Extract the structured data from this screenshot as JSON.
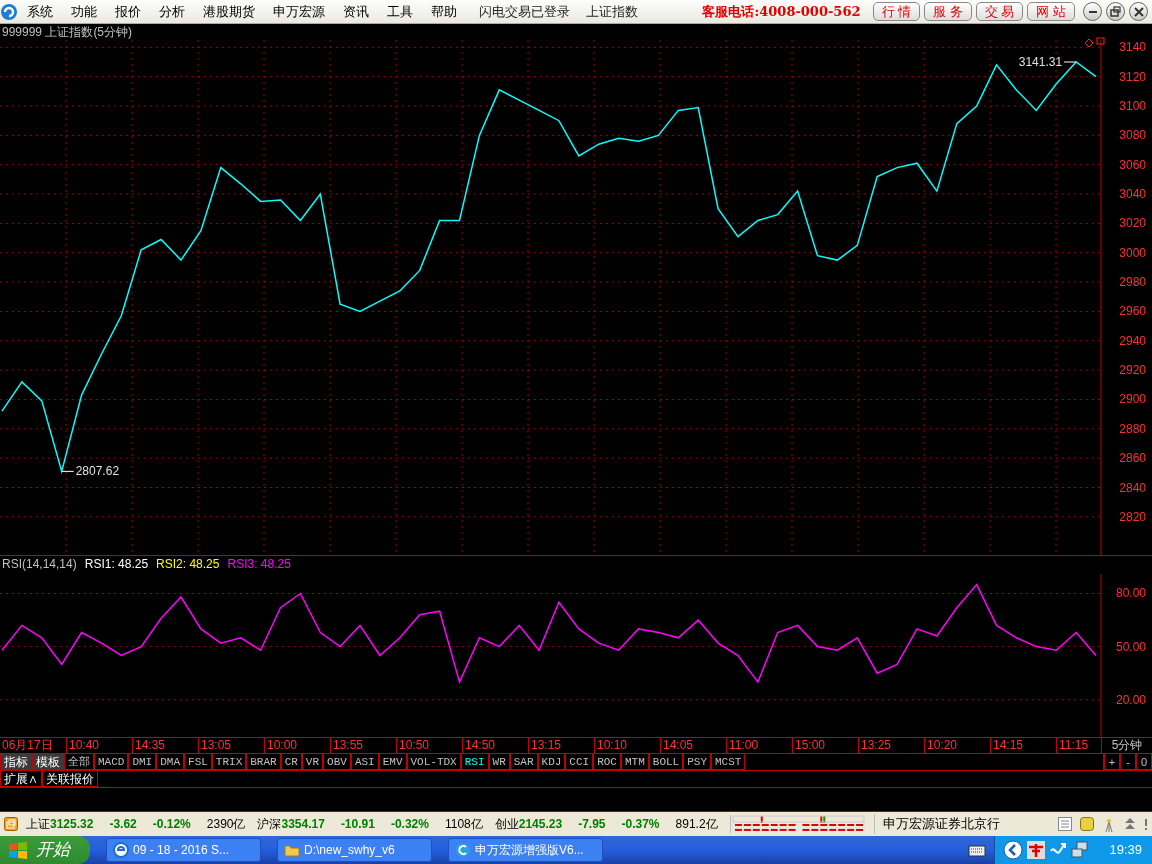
{
  "menu": {
    "items": [
      "系统",
      "功能",
      "报价",
      "分析",
      "港股期货",
      "申万宏源",
      "资讯",
      "工具",
      "帮助"
    ],
    "status_texts": [
      "闪电交易已登录",
      "上证指数"
    ],
    "hotline": "客服电话:4008-000-562",
    "buttons": [
      "行 情",
      "服 务",
      "交 易",
      "网 站"
    ]
  },
  "price_chart": {
    "chart_data": {
      "type": "line",
      "title": "999999 上证指数(5分钟)",
      "ylim": [
        2794,
        3145
      ],
      "grid": true,
      "yticks": [
        2820,
        2840,
        2860,
        2880,
        2900,
        2920,
        2940,
        2960,
        2980,
        3000,
        3020,
        3040,
        3060,
        3080,
        3100,
        3120,
        3140
      ],
      "series": [
        {
          "color": "#00ffff",
          "values": [
            2892,
            2912,
            2899,
            2851,
            2903,
            2931,
            2957,
            3002,
            3009,
            2995,
            3015,
            3058,
            3047,
            3035,
            3036,
            3022,
            3040,
            2965,
            2960,
            2967,
            2974,
            2988,
            3022,
            3022,
            3080,
            3111,
            3104,
            3097,
            3090,
            3066,
            3074,
            3078,
            3076,
            3080,
            3097,
            3099,
            3030,
            3011,
            3022,
            3026,
            3042,
            2998,
            2995,
            3005,
            3052,
            3058,
            3061,
            3042,
            3088,
            3100,
            3128,
            3111,
            3097,
            3115,
            3130,
            3120
          ]
        }
      ],
      "annotations": [
        "3141.31",
        "2807.62"
      ]
    }
  },
  "rsi_chart": {
    "legend": [
      {
        "text": "RSI(14,14,14)",
        "color": "#c0c0c0"
      },
      {
        "text": "RSI1: 48.25",
        "color": "#ffffff"
      },
      {
        "text": "RSI2: 48.25",
        "color": "#ffff00"
      },
      {
        "text": "RSI3: 48.25",
        "color": "#ff00ff"
      }
    ],
    "chart_data": {
      "type": "line",
      "ylim": [
        -1,
        91
      ],
      "grid": true,
      "yticks": [
        {
          "value": 20,
          "label": "20.00"
        },
        {
          "value": 50,
          "label": "50.00"
        },
        {
          "value": 80,
          "label": "80.00"
        }
      ],
      "series": [
        {
          "color": "#ff00ff",
          "values": [
            48,
            62,
            55,
            40,
            58,
            52,
            45,
            50,
            66,
            78,
            60,
            52,
            55,
            48,
            72,
            80,
            58,
            50,
            62,
            45,
            55,
            68,
            70,
            30,
            55,
            50,
            62,
            48,
            75,
            60,
            52,
            48,
            60,
            58,
            55,
            65,
            52,
            45,
            30,
            58,
            62,
            50,
            48,
            55,
            35,
            40,
            60,
            56,
            72,
            85,
            62,
            55,
            50,
            48,
            58,
            45
          ]
        }
      ]
    }
  },
  "time_axis": {
    "labels": [
      "06月17日",
      "10:40",
      "14:35",
      "13:05",
      "10:00",
      "13:55",
      "10:50",
      "14:50",
      "13:15",
      "10:10",
      "14:05",
      "11:00",
      "15:00",
      "13:25",
      "10:20",
      "14:15",
      "11:15"
    ],
    "period": "5分钟"
  },
  "indicator_tabs": [
    {
      "label": "指标",
      "kind": "mode",
      "selected": false
    },
    {
      "label": "模板",
      "kind": "mode",
      "selected": false
    },
    {
      "label": "全部",
      "kind": "indicator",
      "selected": false
    },
    {
      "label": "MACD",
      "kind": "indicator",
      "selected": false
    },
    {
      "label": "DMI",
      "kind": "indicator",
      "selected": false
    },
    {
      "label": "DMA",
      "kind": "indicator",
      "selected": false
    },
    {
      "label": "FSL",
      "kind": "indicator",
      "selected": false
    },
    {
      "label": "TRIX",
      "kind": "indicator",
      "selected": false
    },
    {
      "label": "BRAR",
      "kind": "indicator",
      "selected": false
    },
    {
      "label": "CR",
      "kind": "indicator",
      "selected": false
    },
    {
      "label": "VR",
      "kind": "indicator",
      "selected": false
    },
    {
      "label": "OBV",
      "kind": "indicator",
      "selected": false
    },
    {
      "label": "ASI",
      "kind": "indicator",
      "selected": false
    },
    {
      "label": "EMV",
      "kind": "indicator",
      "selected": false
    },
    {
      "label": "VOL-TDX",
      "kind": "indicator",
      "selected": false
    },
    {
      "label": "RSI",
      "kind": "indicator",
      "selected": true
    },
    {
      "label": "WR",
      "kind": "indicator",
      "selected": false
    },
    {
      "label": "SAR",
      "kind": "indicator",
      "selected": false
    },
    {
      "label": "KDJ",
      "kind": "indicator",
      "selected": false
    },
    {
      "label": "CCI",
      "kind": "indicator",
      "selected": false
    },
    {
      "label": "ROC",
      "kind": "indicator",
      "selected": false
    },
    {
      "label": "MTM",
      "kind": "indicator",
      "selected": false
    },
    {
      "label": "BOLL",
      "kind": "indicator",
      "selected": false
    },
    {
      "label": "PSY",
      "kind": "indicator",
      "selected": false
    },
    {
      "label": "MCST",
      "kind": "indicator",
      "selected": false
    }
  ],
  "zoom_buttons": [
    "+",
    "-",
    "0"
  ],
  "extra_tabs": [
    "扩展∧",
    "关联报价"
  ],
  "status_bar": {
    "quotes": [
      {
        "label": "上证",
        "price": "3125.32",
        "change": "-3.62",
        "pct": "-0.12%",
        "volume": "2390亿"
      },
      {
        "label": "沪深",
        "price": "3354.17",
        "change": "-10.91",
        "pct": "-0.32%",
        "volume": "1108亿"
      },
      {
        "label": "创业",
        "price": "2145.23",
        "change": "-7.95",
        "pct": "-0.37%",
        "volume": "891.2亿"
      }
    ],
    "broker": "申万宏源证券北京行"
  },
  "taskbar": {
    "start": "开始",
    "windows": [
      "09 - 18 - 2016 S...",
      "D:\\new_swhy_v6",
      "申万宏源增强版V6..."
    ],
    "clock": "19:39"
  }
}
